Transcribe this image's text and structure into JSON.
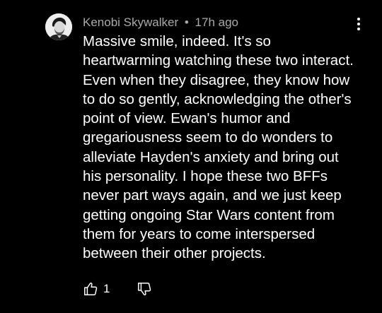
{
  "comment": {
    "author": "Kenobi Skywalker",
    "separator": "•",
    "timestamp": "17h ago",
    "text": "Massive smile, indeed. It's so\nheartwarming watching these two interact.\nEven when they disagree, they know how\nto do so gently, acknowledging the other's\npoint of view. Ewan's humor and\ngregariousness seem to do wonders to\nalleviate Hayden's anxiety and bring out\nhis personality. I hope these two BFFs\nnever part ways again, and we just keep\ngetting ongoing Star Wars content from\nthem for years to come interspersed\nbetween their other projects.",
    "like_count": "1",
    "icons": {
      "avatar": "avatar-image",
      "menu": "more-vertical-icon",
      "like": "thumbs-up-icon",
      "dislike": "thumbs-down-icon"
    }
  },
  "colors": {
    "background": "#000000",
    "text": "#ffffff",
    "meta": "#aaaaaa"
  }
}
